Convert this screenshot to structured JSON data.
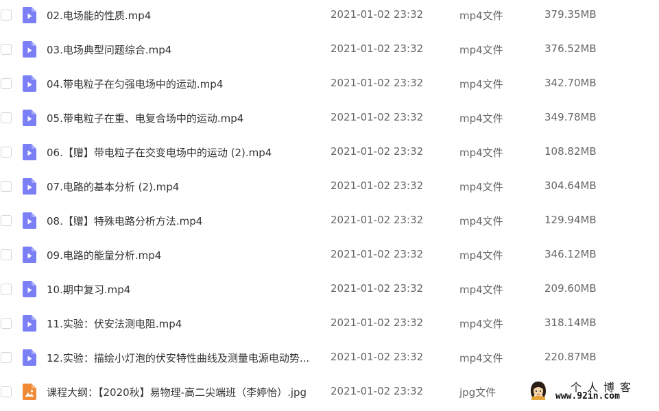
{
  "files": [
    {
      "name": "02.电场能的性质.mp4",
      "date": "2021-01-02 23:32",
      "type": "mp4文件",
      "size": "379.35MB",
      "icon": "video-file-icon"
    },
    {
      "name": "03.电场典型问题综合.mp4",
      "date": "2021-01-02 23:32",
      "type": "mp4文件",
      "size": "376.52MB",
      "icon": "video-file-icon"
    },
    {
      "name": "04.带电粒子在匀强电场中的运动.mp4",
      "date": "2021-01-02 23:32",
      "type": "mp4文件",
      "size": "342.70MB",
      "icon": "video-file-icon"
    },
    {
      "name": "05.带电粒子在重、电复合场中的运动.mp4",
      "date": "2021-01-02 23:32",
      "type": "mp4文件",
      "size": "349.78MB",
      "icon": "video-file-icon"
    },
    {
      "name": "06.【赠】带电粒子在交变电场中的运动 (2).mp4",
      "date": "2021-01-02 23:32",
      "type": "mp4文件",
      "size": "108.82MB",
      "icon": "video-file-icon"
    },
    {
      "name": "07.电路的基本分析 (2).mp4",
      "date": "2021-01-02 23:32",
      "type": "mp4文件",
      "size": "304.64MB",
      "icon": "video-file-icon"
    },
    {
      "name": "08.【赠】特殊电路分析方法.mp4",
      "date": "2021-01-02 23:32",
      "type": "mp4文件",
      "size": "129.94MB",
      "icon": "video-file-icon"
    },
    {
      "name": "09.电路的能量分析.mp4",
      "date": "2021-01-02 23:32",
      "type": "mp4文件",
      "size": "346.12MB",
      "icon": "video-file-icon"
    },
    {
      "name": "10.期中复习.mp4",
      "date": "2021-01-02 23:32",
      "type": "mp4文件",
      "size": "209.60MB",
      "icon": "video-file-icon"
    },
    {
      "name": "11.实验：伏安法测电阻.mp4",
      "date": "2021-01-02 23:32",
      "type": "mp4文件",
      "size": "318.14MB",
      "icon": "video-file-icon"
    },
    {
      "name": "12.实验：描绘小灯泡的伏安特性曲线及测量电源电动势...",
      "date": "2021-01-02 23:32",
      "type": "mp4文件",
      "size": "220.87MB",
      "icon": "video-file-icon"
    },
    {
      "name": "课程大纲：【2020秋】易物理-高二尖端班（李婷怡）.jpg",
      "date": "2021-01-02 23:32",
      "type": "jpg文件",
      "size": "",
      "icon": "image-file-icon"
    }
  ],
  "watermark": {
    "title": "个人博客",
    "url": "www.92in.com"
  },
  "colors": {
    "video_icon": "#7b7ff5",
    "image_icon": "#f08a35"
  }
}
